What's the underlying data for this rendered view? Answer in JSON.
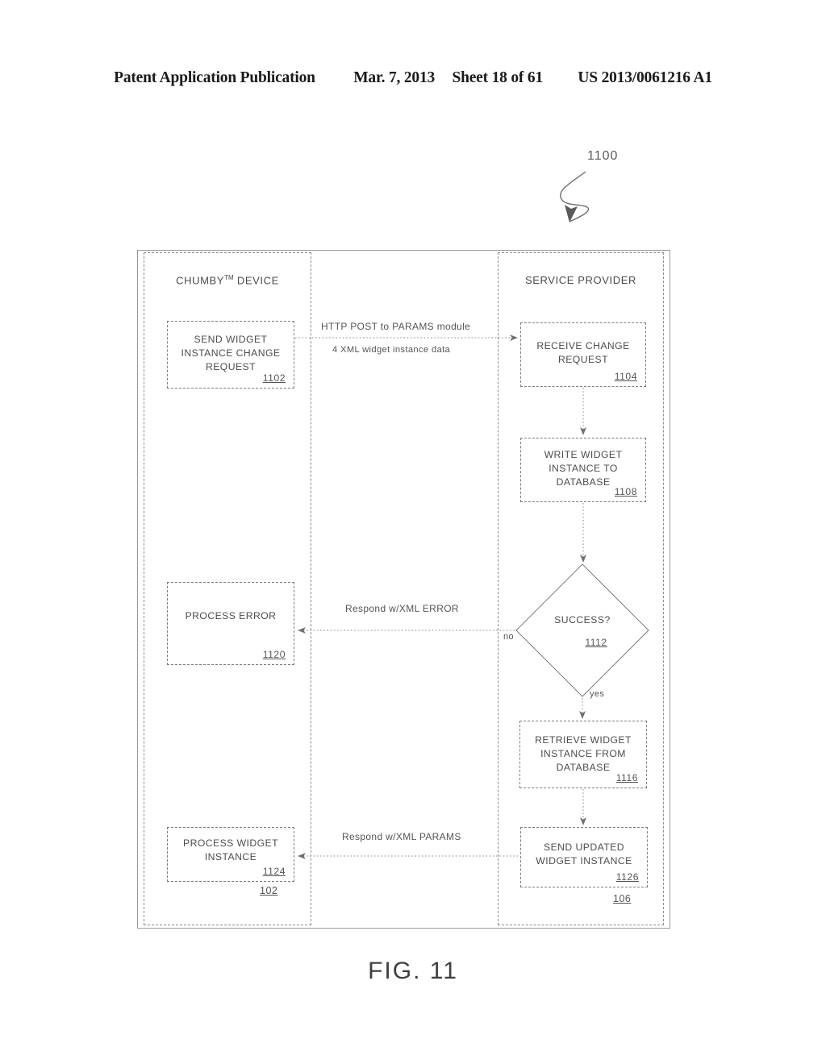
{
  "header": {
    "publication": "Patent Application Publication",
    "date": "Mar. 7, 2013",
    "sheet": "Sheet 18 of 61",
    "patent_number": "US 2013/0061216 A1"
  },
  "figure": {
    "caption": "FIG. 11",
    "callout_ref": "1100"
  },
  "lanes": [
    {
      "title": "CHUMBY",
      "title_sup": "TM",
      "title_suffix": " DEVICE",
      "ref": "102"
    },
    {
      "title": "SERVICE PROVIDER",
      "title_sup": "",
      "title_suffix": "",
      "ref": "106"
    }
  ],
  "nodes": {
    "n1102": {
      "label": "SEND WIDGET\nINSTANCE CHANGE\nREQUEST",
      "ref": "1102"
    },
    "n1104": {
      "label": "RECEIVE CHANGE\nREQUEST",
      "ref": "1104"
    },
    "n1108": {
      "label": "WRITE WIDGET\nINSTANCE TO\nDATABASE",
      "ref": "1108"
    },
    "n1112": {
      "label": "SUCCESS?",
      "ref": "1112"
    },
    "n1116": {
      "label": "RETRIEVE WIDGET\nINSTANCE FROM\nDATABASE",
      "ref": "1116"
    },
    "n1120": {
      "label": "PROCESS ERROR",
      "ref": "1120"
    },
    "n1124": {
      "label": "PROCESS WIDGET\nINSTANCE",
      "ref": "1124"
    },
    "n1126": {
      "label": "SEND UPDATED\nWIDGET INSTANCE",
      "ref": "1126"
    }
  },
  "edges": {
    "post_top": "HTTP POST to PARAMS  module",
    "post_bottom": "4 XML widget instance data",
    "error_response": "Respond w/XML ERROR",
    "params_response": "Respond w/XML PARAMS",
    "branch_no": "no",
    "branch_yes": "yes"
  },
  "colors": {
    "ink": "#4d4d4d",
    "line": "#7d7d7d",
    "lane_border": "#8a8a8a",
    "background": "#ffffff"
  }
}
